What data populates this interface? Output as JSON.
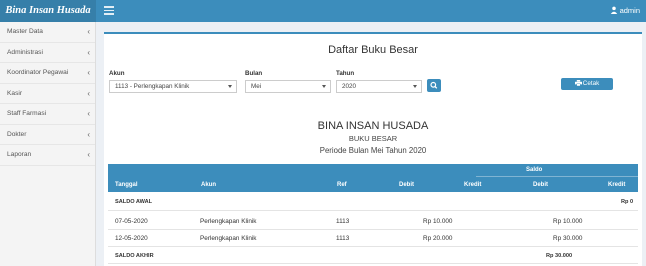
{
  "header": {
    "logo": "Bina Insan Husada",
    "user": "admin"
  },
  "sidebar": {
    "items": [
      {
        "label": "Master Data"
      },
      {
        "label": "Administrasi"
      },
      {
        "label": "Koordinator Pegawai"
      },
      {
        "label": "Kasir"
      },
      {
        "label": "Staff Farmasi"
      },
      {
        "label": "Dokter"
      },
      {
        "label": "Laporan"
      }
    ]
  },
  "page": {
    "title": "Daftar Buku Besar"
  },
  "filters": {
    "akun_label": "Akun",
    "akun_value": "1113 - Perlengkapan Klinik",
    "bulan_label": "Bulan",
    "bulan_value": "Mei",
    "tahun_label": "Tahun",
    "tahun_value": "2020",
    "cetak_label": "Cetak"
  },
  "report": {
    "company": "BINA INSAN HUSADA",
    "subtitle": "BUKU BESAR",
    "period": "Periode Bulan Mei Tahun 2020"
  },
  "table": {
    "saldo_header": "Saldo",
    "columns": {
      "tanggal": "Tanggal",
      "akun": "Akun",
      "ref": "Ref",
      "debit": "Debit",
      "kredit": "Kredit",
      "saldo_debit": "Debit",
      "saldo_kredit": "Kredit"
    },
    "saldo_awal": {
      "label": "SALDO AWAL",
      "value": "Rp 0"
    },
    "rows": [
      {
        "tanggal": "07-05-2020",
        "akun": "Perlengkapan Klinik",
        "ref": "1113",
        "debit": "Rp 10.000",
        "saldo_debit": "Rp 10.000"
      },
      {
        "tanggal": "12-05-2020",
        "akun": "Perlengkapan Klinik",
        "ref": "1113",
        "debit": "Rp 20.000",
        "saldo_debit": "Rp 30.000"
      }
    ],
    "saldo_akhir": {
      "label": "SALDO AKHIR",
      "value": "Rp 30.000"
    }
  },
  "colors": {
    "primary": "#3c8dbc",
    "logo_bg": "#367fa9",
    "page_bg": "#ecf0f5"
  },
  "icons": {
    "menu": "hamburger-icon",
    "user": "user-icon",
    "search": "search-icon",
    "print": "print-icon"
  }
}
